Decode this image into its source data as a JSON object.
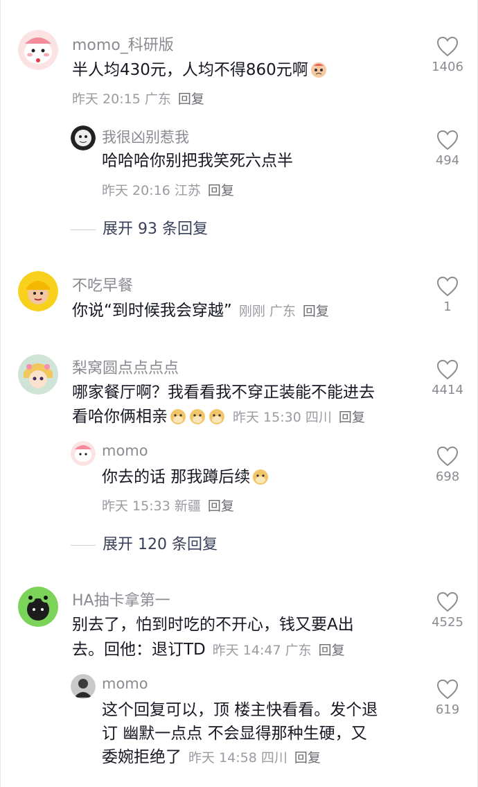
{
  "comments": [
    {
      "user": "momo_科研版",
      "text": "半人均430元，人均不得860元啊",
      "time": "昨天 20:15",
      "location": "广东",
      "reply_label": "回复",
      "likes": "1406",
      "avatar_icon": "pink-bunny-avatar",
      "emoji": "cry-face-emoji"
    },
    {
      "user": "我很凶别惹我",
      "text": "哈哈哈你别把我笑死六点半",
      "time": "昨天 20:16",
      "location": "江苏",
      "reply_label": "回复",
      "likes": "494",
      "avatar_icon": "black-white-cartoon-avatar"
    },
    {
      "expand_label": "展开 93 条回复"
    },
    {
      "user": "不吃早餐",
      "text": "你说“到时候我会穿越”",
      "time": "刚刚",
      "location": "广东",
      "reply_label": "回复",
      "likes": "1",
      "avatar_icon": "yellow-helmet-avatar"
    },
    {
      "user": "梨窝圆点点点点",
      "text_line1": "哪家餐厅啊？我看看我不穿正装能不能进去",
      "text_line2": "看哈你俩相亲",
      "time": "昨天 15:30",
      "location": "四川",
      "reply_label": "回复",
      "likes": "4414",
      "avatar_icon": "anime-girl-avatar",
      "emoji": "doge-emoji"
    },
    {
      "user": "momo",
      "text": "你去的话 那我蹲后续",
      "time": "昨天 15:33",
      "location": "新疆",
      "reply_label": "回复",
      "likes": "698",
      "avatar_icon": "pink-bunny-avatar",
      "emoji": "doge-emoji"
    },
    {
      "expand_label": "展开 120 条回复"
    },
    {
      "user": "HA抽卡拿第一",
      "text_line1": "别去了，怕到时吃的不开心，钱又要A出",
      "text_line2": "去。回他：退订TD",
      "time": "昨天 14:47",
      "location": "广东",
      "reply_label": "回复",
      "likes": "4525",
      "avatar_icon": "green-frog-avatar"
    },
    {
      "user": "momo",
      "text_line1": "这个回复可以，顶 楼主快看看。发个退",
      "text_line2": "订 幽默一点点 不会显得那种生硬，又",
      "text_line3": "委婉拒绝了",
      "time": "昨天 14:58",
      "location": "四川",
      "reply_label": "回复",
      "likes": "619",
      "avatar_icon": "person-photo-avatar"
    }
  ],
  "colors": {
    "text": "#161823",
    "username": "#8a8b91",
    "meta": "#9a9ba1",
    "expand": "#3a3f59"
  }
}
